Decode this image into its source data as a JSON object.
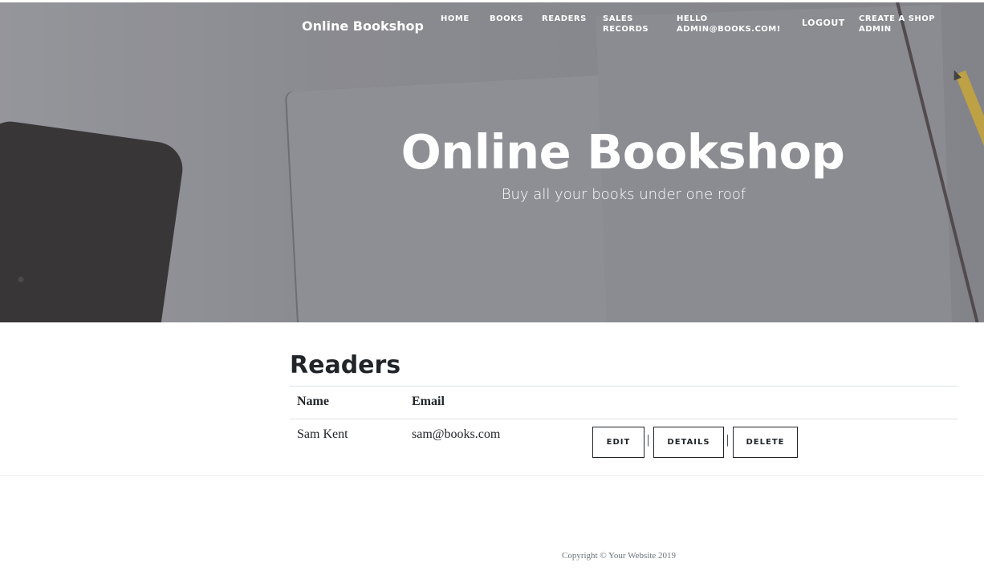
{
  "nav": {
    "brand": "Online Bookshop",
    "items": [
      {
        "line1": "HOME",
        "line2": ""
      },
      {
        "line1": "BOOKS",
        "line2": ""
      },
      {
        "line1": "READERS",
        "line2": ""
      },
      {
        "line1": "SALES",
        "line2": "RECORDS"
      },
      {
        "line1": "HELLO",
        "line2": "ADMIN@BOOKS.COM!"
      },
      {
        "line1": "LOGOUT",
        "line2": ""
      },
      {
        "line1": "CREATE A SHOP",
        "line2": "ADMIN"
      }
    ]
  },
  "hero": {
    "title": "Online Bookshop",
    "subtitle": "Buy all your books under one roof"
  },
  "main": {
    "heading": "Readers",
    "columns": [
      "Name",
      "Email"
    ],
    "rows": [
      {
        "name": "Sam Kent",
        "email": "sam@books.com"
      }
    ],
    "actions": {
      "edit": "EDIT",
      "details": "DETAILS",
      "delete": "DELETE",
      "separator": "|"
    }
  },
  "footer": {
    "copyright": "Copyright © Your Website 2019"
  }
}
